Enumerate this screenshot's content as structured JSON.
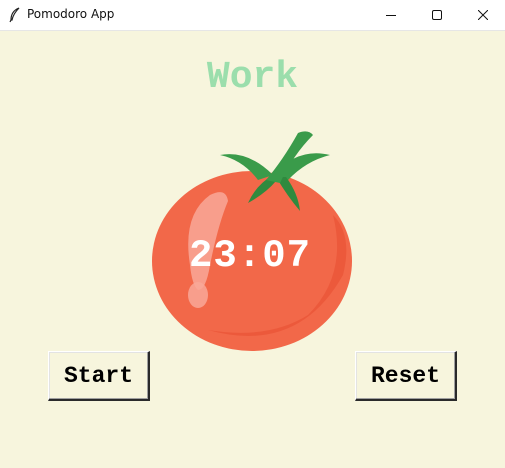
{
  "window": {
    "title": "Pomodoro App"
  },
  "icons": {
    "app": "feather-icon",
    "minimize": "minimize-icon",
    "maximize": "maximize-icon",
    "close": "close-icon",
    "tomato": "tomato-image"
  },
  "colors": {
    "background": "#f7f5dd",
    "heading": "#9bdeac",
    "tomato": "#f26849",
    "leaves": "#3a9b4a",
    "timer_text": "#ffffff"
  },
  "main": {
    "heading": "Work",
    "timer": "23:07"
  },
  "buttons": {
    "start_label": "Start",
    "reset_label": "Reset"
  }
}
